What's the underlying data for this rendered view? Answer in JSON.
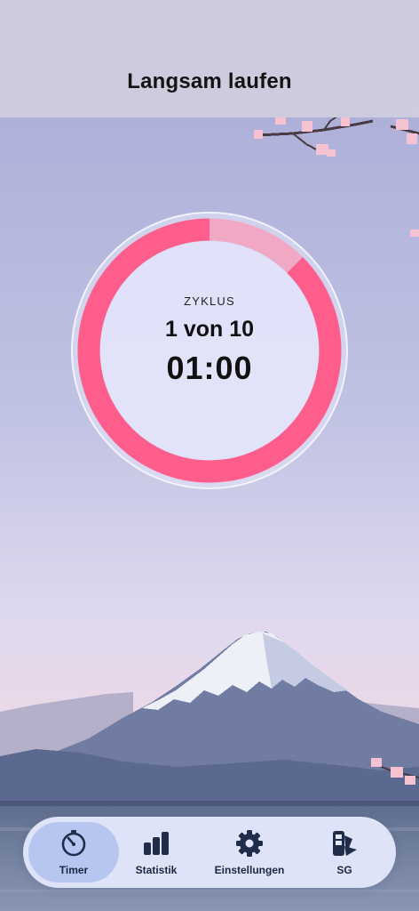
{
  "header": {
    "title": "Langsam laufen"
  },
  "timer": {
    "cycle_label": "ZYKLUS",
    "cycle_text": "1 von 10",
    "countdown": "01:00",
    "progress_fraction": 0.125
  },
  "tabs": [
    {
      "label": "Timer",
      "icon": "stopwatch-icon",
      "active": true
    },
    {
      "label": "Statistik",
      "icon": "bar-chart-icon",
      "active": false
    },
    {
      "label": "Einstellungen",
      "icon": "gear-icon",
      "active": false
    },
    {
      "label": "SG",
      "icon": "color-swatch-icon",
      "active": false
    }
  ],
  "colors": {
    "accent": "#ff5d8c",
    "ring_track": "#f0a8c4",
    "tab_text": "#1a2642",
    "active_tab_bg": "#a9bceb"
  }
}
